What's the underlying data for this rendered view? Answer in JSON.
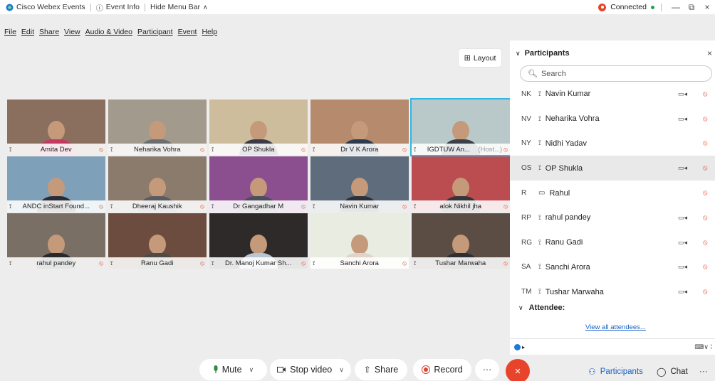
{
  "titlebar": {
    "app_name": "Cisco Webex Events",
    "event_info": "Event Info",
    "hide_menu": "Hide Menu Bar",
    "connected": "Connected",
    "minimize": "—",
    "restore": "⧉",
    "close": "×"
  },
  "menu": [
    "File",
    "Edit",
    "Share",
    "View",
    "Audio & Video",
    "Participant",
    "Event",
    "Help"
  ],
  "layout_label": "Layout",
  "tiles": [
    {
      "name": "Amita Dev",
      "host": "",
      "bg": "#8b6f5e",
      "shirt": "#c23a63"
    },
    {
      "name": "Neharika Vohra",
      "host": "",
      "bg": "#a29a8c",
      "shirt": "#6b6d70"
    },
    {
      "name": "OP Shukla",
      "host": "",
      "bg": "#cdbd9c",
      "shirt": "#3a3a48"
    },
    {
      "name": "Dr V K Arora",
      "host": "",
      "bg": "#b58a6d",
      "shirt": "#2e3a50"
    },
    {
      "name": "IGDTUW An...",
      "host": "(Host...)",
      "bg": "#b9c9c9",
      "shirt": "#3c4048"
    },
    {
      "name": "ANDC inStart Found...",
      "host": "",
      "bg": "#7fa0b9",
      "shirt": "#2a2c35"
    },
    {
      "name": "Dheeraj Kaushik",
      "host": "",
      "bg": "#8a7b6d",
      "shirt": "#5b5b5f"
    },
    {
      "name": "Dr Gangadhar M",
      "host": "",
      "bg": "#8b4f8f",
      "shirt": "#4b4f58"
    },
    {
      "name": "Navin Kumar",
      "host": "",
      "bg": "#5f6c7c",
      "shirt": "#2d3038"
    },
    {
      "name": "alok Nikhil jha",
      "host": "",
      "bg": "#bb4c4f",
      "shirt": "#34343a"
    },
    {
      "name": "rahul pandey",
      "host": "",
      "bg": "#7a6f65",
      "shirt": "#27292d"
    },
    {
      "name": "Ranu Gadi",
      "host": "",
      "bg": "#6b4c3e",
      "shirt": "#4e4a46"
    },
    {
      "name": "Dr. Manoj Kumar Sh...",
      "host": "",
      "bg": "#2f2a2a",
      "shirt": "#b8c5d2"
    },
    {
      "name": "Sanchi Arora",
      "host": "",
      "bg": "#e9ece1",
      "shirt": "#e2d2c8"
    },
    {
      "name": "Tushar Marwaha",
      "host": "",
      "bg": "#5b4d43",
      "shirt": "#2e2f34"
    }
  ],
  "panel": {
    "title": "Participants",
    "close": "×",
    "search_placeholder": "Search",
    "participants": [
      {
        "initials": "NK",
        "name": "Navin Kumar",
        "video": true
      },
      {
        "initials": "NV",
        "name": "Neharika Vohra",
        "video": true
      },
      {
        "initials": "NY",
        "name": "Nidhi Yadav",
        "video": false
      },
      {
        "initials": "OS",
        "name": "OP Shukla",
        "video": true
      },
      {
        "initials": "R",
        "name": "Rahul",
        "video": false
      },
      {
        "initials": "RP",
        "name": "rahul pandey",
        "video": true
      },
      {
        "initials": "RG",
        "name": "Ranu Gadi",
        "video": true
      },
      {
        "initials": "SA",
        "name": "Sanchi Arora",
        "video": true
      },
      {
        "initials": "TM",
        "name": "Tushar Marwaha",
        "video": true
      }
    ],
    "attendee_label": "Attendee:",
    "view_all": "View all attendees..."
  },
  "controls": {
    "mute": "Mute",
    "stop_video": "Stop video",
    "share": "Share",
    "record": "Record",
    "more": "···",
    "end": "×",
    "participants": "Participants",
    "chat": "Chat",
    "more_right": "···"
  },
  "colors": {
    "end_red": "#e8432b",
    "accent_blue": "#1a62c4",
    "active_outline": "#31b7e6"
  }
}
